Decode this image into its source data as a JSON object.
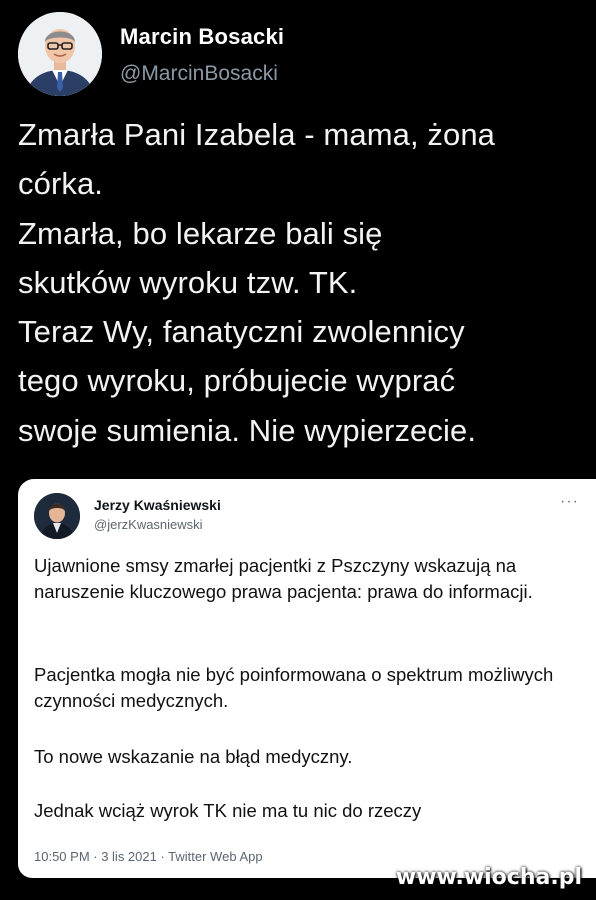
{
  "tweet": {
    "author_name": "Marcin Bosacki",
    "author_handle": "@MarcinBosacki",
    "text": "Zmarła Pani Izabela - mama, żona\ncórka.\nZmarła, bo lekarze bali się\nskutków wyroku tzw. TK.\nTeraz Wy, fanatyczni zwolennicy\ntego wyroku, próbujecie wyprać\nswoje sumienia. Nie wypierzecie."
  },
  "quoted": {
    "author_name": "Jerzy Kwaśniewski",
    "author_handle": "@jerzKwasniewski",
    "more_label": "···",
    "paragraphs": [
      "Ujawnione smsy zmarłej pacjentki z Pszczyny wskazują na naruszenie kluczowego prawa pacjenta: prawa do informacji.",
      "Pacjentka mogła nie być poinformowana o spektrum możliwych czynności medycznych.",
      "To nowe wskazanie na błąd medyczny.",
      "Jednak wciąż wyrok TK nie ma tu nic do rzeczy"
    ],
    "footer": "10:50 PM · 3 lis 2021 · Twitter Web App"
  },
  "watermark": "www.wiocha.pl",
  "icons": {
    "author_avatar": "avatar-photo",
    "quoted_avatar": "avatar-photo",
    "more": "more-options-icon"
  },
  "colors": {
    "background": "#000000",
    "handle": "#8b98a5",
    "card": "#ffffff"
  }
}
